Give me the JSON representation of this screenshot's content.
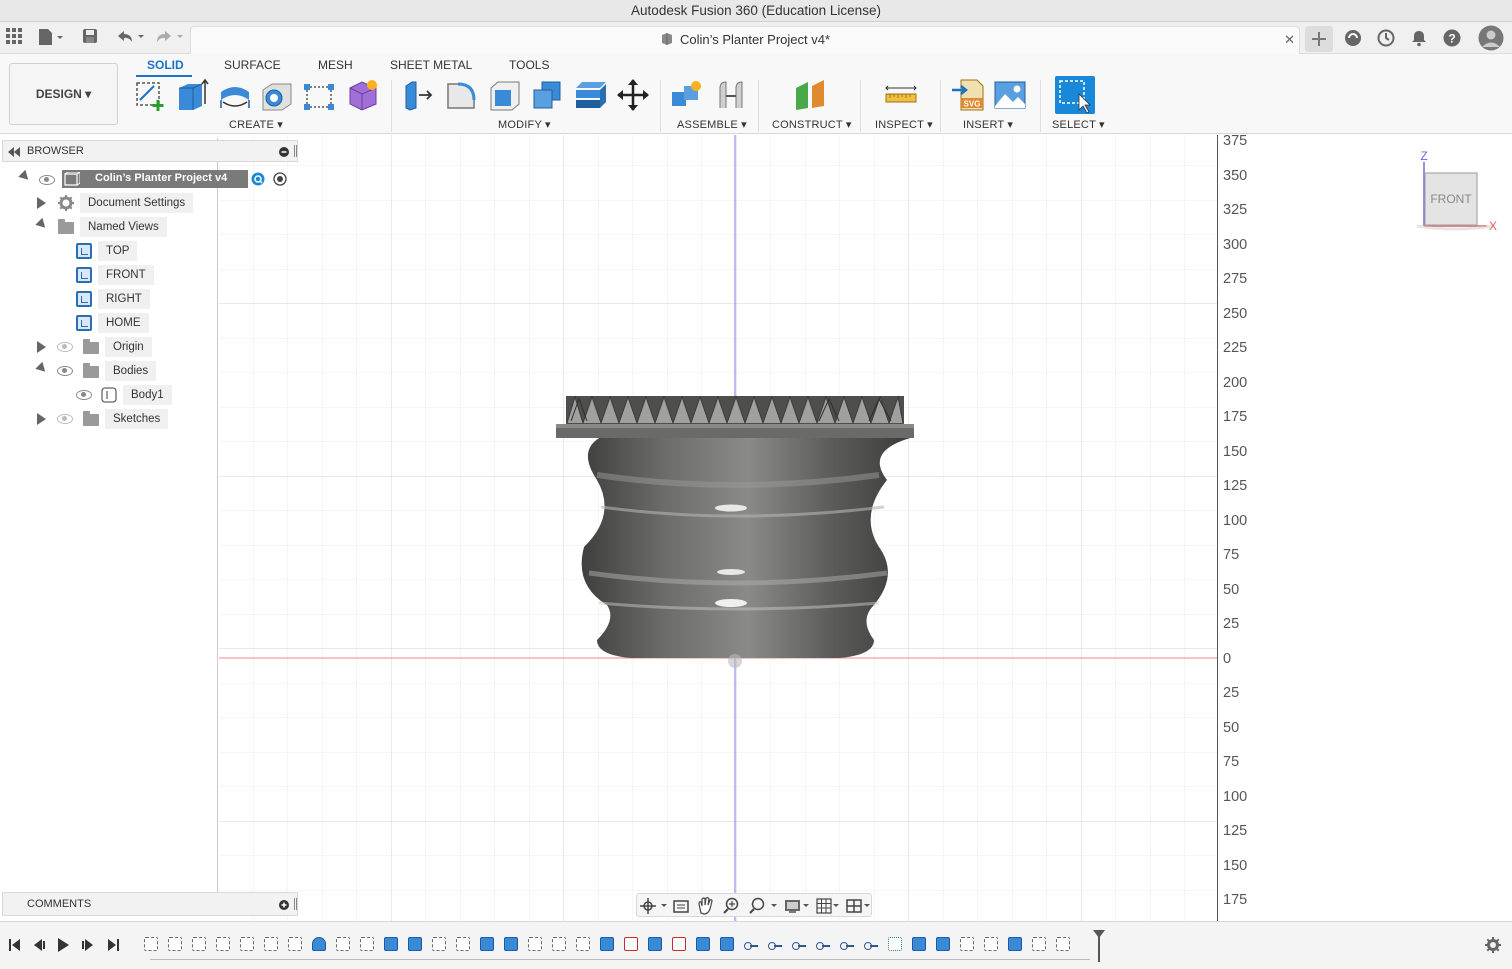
{
  "window": {
    "title": "Autodesk Fusion 360 (Education License)"
  },
  "document_tab": {
    "title": "Colin’s Planter Project v4*",
    "close": "✕"
  },
  "workspace": {
    "label": "DESIGN ▾"
  },
  "ribbon": {
    "tabs": [
      "SOLID",
      "SURFACE",
      "MESH",
      "SHEET METAL",
      "TOOLS"
    ],
    "active_tab": "SOLID",
    "groups": [
      "CREATE ▾",
      "MODIFY ▾",
      "ASSEMBLE ▾",
      "CONSTRUCT ▾",
      "INSPECT ▾",
      "INSERT ▾",
      "SELECT ▾"
    ]
  },
  "browser": {
    "title": "BROWSER",
    "root": "Colin’s Planter Project v4",
    "items": [
      {
        "label": "Document Settings"
      },
      {
        "label": "Named Views"
      },
      {
        "label": "TOP"
      },
      {
        "label": "FRONT"
      },
      {
        "label": "RIGHT"
      },
      {
        "label": "HOME"
      },
      {
        "label": "Origin"
      },
      {
        "label": "Bodies"
      },
      {
        "label": "Body1"
      },
      {
        "label": "Sketches"
      }
    ]
  },
  "comments": {
    "title": "COMMENTS"
  },
  "viewcube": {
    "face": "FRONT",
    "axis_z": "Z",
    "axis_x": "X"
  },
  "ruler": {
    "ticks": [
      "375",
      "350",
      "325",
      "300",
      "275",
      "250",
      "225",
      "200",
      "175",
      "150",
      "125",
      "100",
      "75",
      "50",
      "25",
      "0",
      "25",
      "50",
      "75",
      "100",
      "125",
      "150",
      "175"
    ]
  },
  "colors": {
    "accent": "#1a73c8",
    "x_axis": "#e06060",
    "z_axis": "#6a6ae0",
    "model": "#5e5e5c"
  }
}
